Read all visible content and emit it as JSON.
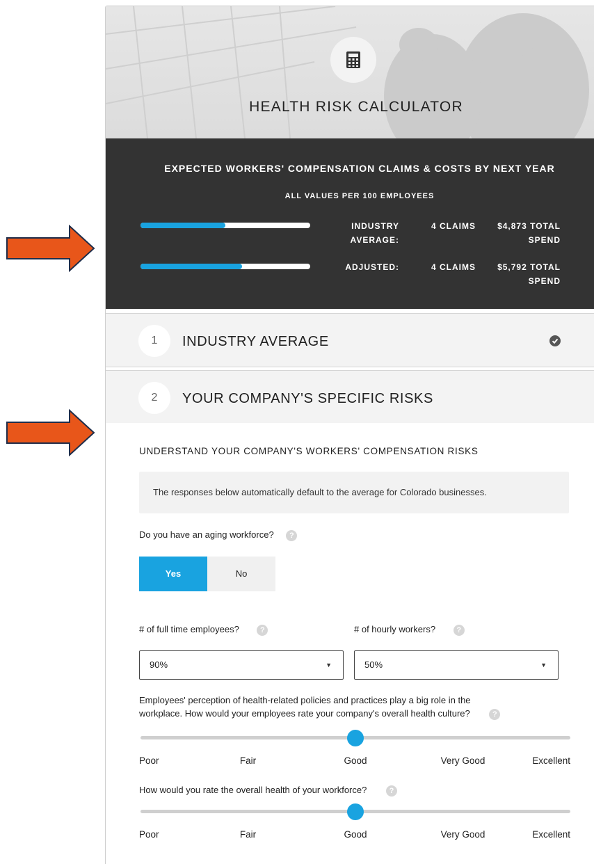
{
  "header": {
    "title": "HEALTH RISK CALCULATOR",
    "icon": "calculator-icon"
  },
  "summary": {
    "title": "EXPECTED WORKERS' COMPENSATION CLAIMS & COSTS BY NEXT YEAR",
    "subtitle": "ALL VALUES PER 100 EMPLOYEES",
    "rows": [
      {
        "label_line1": "INDUSTRY",
        "label_line2": "AVERAGE:",
        "claims": "4 CLAIMS",
        "spend_line1": "$4,873 TOTAL",
        "spend_line2": "SPEND",
        "bar_fraction": 0.5
      },
      {
        "label_line1": "ADJUSTED:",
        "label_line2": "",
        "claims": "4 CLAIMS",
        "spend_line1": "$5,792 TOTAL",
        "spend_line2": "SPEND",
        "bar_fraction": 0.6
      }
    ]
  },
  "steps": [
    {
      "number": "1",
      "title": "INDUSTRY AVERAGE",
      "completed": true
    },
    {
      "number": "2",
      "title": "YOUR COMPANY'S SPECIFIC RISKS",
      "completed": false
    }
  ],
  "risks": {
    "heading": "UNDERSTAND YOUR COMPANY'S WORKERS' COMPENSATION RISKS",
    "notice": "The responses below automatically default to the average for Colorado businesses.",
    "aging_question": "Do you have an aging workforce?",
    "aging_options": [
      "Yes",
      "No"
    ],
    "aging_selected": "Yes",
    "fulltime_label": "# of full time employees?",
    "fulltime_value": "90%",
    "hourly_label": "# of hourly workers?",
    "hourly_value": "50%",
    "culture_question_line1": "Employees' perception of health-related policies and practices play a big role in the",
    "culture_question_line2": "workplace. How would your employees rate your company's overall health culture?",
    "culture_value": "Good",
    "health_question": "How would you rate the overall health of your workforce?",
    "health_value": "Good",
    "scale": [
      "Poor",
      "Fair",
      "Good",
      "Very Good",
      "Excellent"
    ]
  },
  "colors": {
    "accent": "#19a3e0",
    "arrow": "#e8561a",
    "dark_panel": "#333333"
  },
  "help_glyph": "?"
}
